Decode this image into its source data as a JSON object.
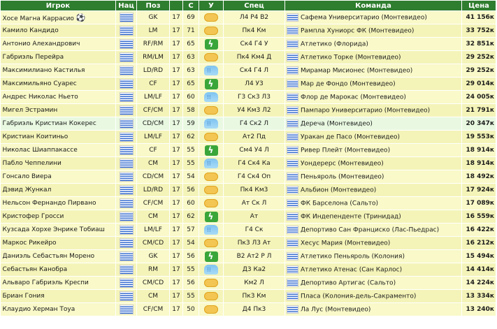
{
  "columns": [
    "Игрок",
    "Нац",
    "Поз",
    "",
    "С",
    "У",
    "Спец",
    "Команда",
    "Цена"
  ],
  "rows": [
    {
      "name": "Хосе Магна Каррасио",
      "pos": "GK",
      "age": "17",
      "s": "69",
      "w": "sun",
      "spec": "Л4 Р4 В2",
      "team": "Сафема Университарио (Монтевидео)",
      "price": "41 156к",
      "ball": true
    },
    {
      "name": "Камило Кандидо",
      "pos": "LM",
      "age": "17",
      "s": "71",
      "w": "sun",
      "spec": "Пк4 Км",
      "team": "Рампла Хуниорс ФК (Монтевидео)",
      "price": "33 752к"
    },
    {
      "name": "Антонио Алехандрович",
      "pos": "RF/RM",
      "age": "17",
      "s": "65",
      "w": "green",
      "spec": "Ск4 Г4 У",
      "team": "Атлетико (Флорида)",
      "price": "32 851к"
    },
    {
      "name": "Габриэль Перейра",
      "pos": "RM/LM",
      "age": "17",
      "s": "63",
      "w": "sun",
      "spec": "Пк4 Км4 Д",
      "team": "Атлетико Торке (Монтевидео)",
      "price": "29 252к"
    },
    {
      "name": "Максимилиано Кастилья",
      "pos": "LD/RD",
      "age": "17",
      "s": "63",
      "w": "rain",
      "spec": "Ск4 Г4 Л",
      "team": "Мирамар Мисионес (Монтевидео)",
      "price": "29 252к"
    },
    {
      "name": "Максимильяно Суарес",
      "pos": "CF",
      "age": "17",
      "s": "65",
      "w": "green",
      "spec": "Л4 У3",
      "team": "Мар де Фондо (Монтевидео)",
      "price": "29 014к"
    },
    {
      "name": "Андрес Николас Ньето",
      "pos": "LM/LF",
      "age": "17",
      "s": "60",
      "w": "rain",
      "spec": "Г3 Ск3 Л3",
      "team": "Флор де Марокас (Монтевидео)",
      "price": "24 005к"
    },
    {
      "name": "Мигел Эстрамин",
      "pos": "CF/CM",
      "age": "17",
      "s": "58",
      "w": "sun",
      "spec": "У4 Км3 Л2",
      "team": "Пампаро Университарио (Монтевидео)",
      "price": "21 791к"
    },
    {
      "name": "Габриэль Кристиан Кокерес",
      "pos": "CD/CM",
      "age": "17",
      "s": "59",
      "w": "rain",
      "spec": "Г4 Ск2 Л",
      "team": "Дереча (Монтевидео)",
      "price": "20 347к",
      "hl": true
    },
    {
      "name": "Кристиан Коитиньо",
      "pos": "LM/LF",
      "age": "17",
      "s": "62",
      "w": "sun",
      "spec": "Ат2 Пд",
      "team": "Уракан де Пасо (Монтевидео)",
      "price": "19 553к"
    },
    {
      "name": "Николас Шиаппакассе",
      "pos": "CF",
      "age": "17",
      "s": "55",
      "w": "green",
      "spec": "См4 У4 Л",
      "team": "Ривер Плейт (Монтевидео)",
      "price": "18 914к"
    },
    {
      "name": "Пабло Чеппелини",
      "pos": "CM",
      "age": "17",
      "s": "55",
      "w": "rain",
      "spec": "Г4 Ск4 Ка",
      "team": "Уондерерс (Монтевидео)",
      "price": "18 914к"
    },
    {
      "name": "Гонсало Виера",
      "pos": "CD/CM",
      "age": "17",
      "s": "54",
      "w": "sun",
      "spec": "Г4 Ск4 Оп",
      "team": "Пеньяроль (Монтевидео)",
      "price": "18 492к"
    },
    {
      "name": "Дэвид Жункал",
      "pos": "LD/RD",
      "age": "17",
      "s": "56",
      "w": "sun",
      "spec": "Пк4 Км3",
      "team": "Альбион (Монтевидео)",
      "price": "17 924к"
    },
    {
      "name": "Нельсон Фернандо Пирвано",
      "pos": "CF/CM",
      "age": "17",
      "s": "60",
      "w": "sun",
      "spec": "Ат Ск Л",
      "team": "ФК Барселона (Сальто)",
      "price": "17 089к"
    },
    {
      "name": "Кристофер Гросси",
      "pos": "CM",
      "age": "17",
      "s": "62",
      "w": "green",
      "spec": "Ат",
      "team": "ФК Индепенденте (Тринидад)",
      "price": "16 559к"
    },
    {
      "name": "Кузсада Хорхе Энрике Тобиаш",
      "pos": "LM/LF",
      "age": "17",
      "s": "57",
      "w": "rain",
      "spec": "Г4 Ск",
      "team": "Депортиво Сан Франциско (Лас-Пьедрас)",
      "price": "16 422к"
    },
    {
      "name": "Маркос Рикейро",
      "pos": "CM/CD",
      "age": "17",
      "s": "54",
      "w": "sun",
      "spec": "Пк3 Л3 Ат",
      "team": "Хесус Мария (Монтевидео)",
      "price": "16 212к"
    },
    {
      "name": "Даниэль Себастьян Морено",
      "pos": "GK",
      "age": "17",
      "s": "56",
      "w": "green",
      "spec": "В2 Ат2 Р Л",
      "team": "Атлетико Пеньяроль (Колония)",
      "price": "15 494к"
    },
    {
      "name": "Себастьян Канобра",
      "pos": "RM",
      "age": "17",
      "s": "55",
      "w": "rain",
      "spec": "Д3 Ка2",
      "team": "Атлетико Атенас (Сан Карлос)",
      "price": "14 414к"
    },
    {
      "name": "Альваро Габриэль Креспи",
      "pos": "CM/CD",
      "age": "17",
      "s": "56",
      "w": "sun",
      "spec": "Км2 Л",
      "team": "Депортиво Артигас (Сальто)",
      "price": "14 224к"
    },
    {
      "name": "Бриан Гония",
      "pos": "CM",
      "age": "17",
      "s": "55",
      "w": "sun",
      "spec": "Пк3 Км",
      "team": "Пласа (Колония-дель-Сакраменто)",
      "price": "13 334к"
    },
    {
      "name": "Клаудио Херман Тоуа",
      "pos": "CF/CM",
      "age": "17",
      "s": "50",
      "w": "sun",
      "spec": "Д4 Пк3",
      "team": "Ла Лус (Монтевидео)",
      "price": "13 240к"
    }
  ]
}
